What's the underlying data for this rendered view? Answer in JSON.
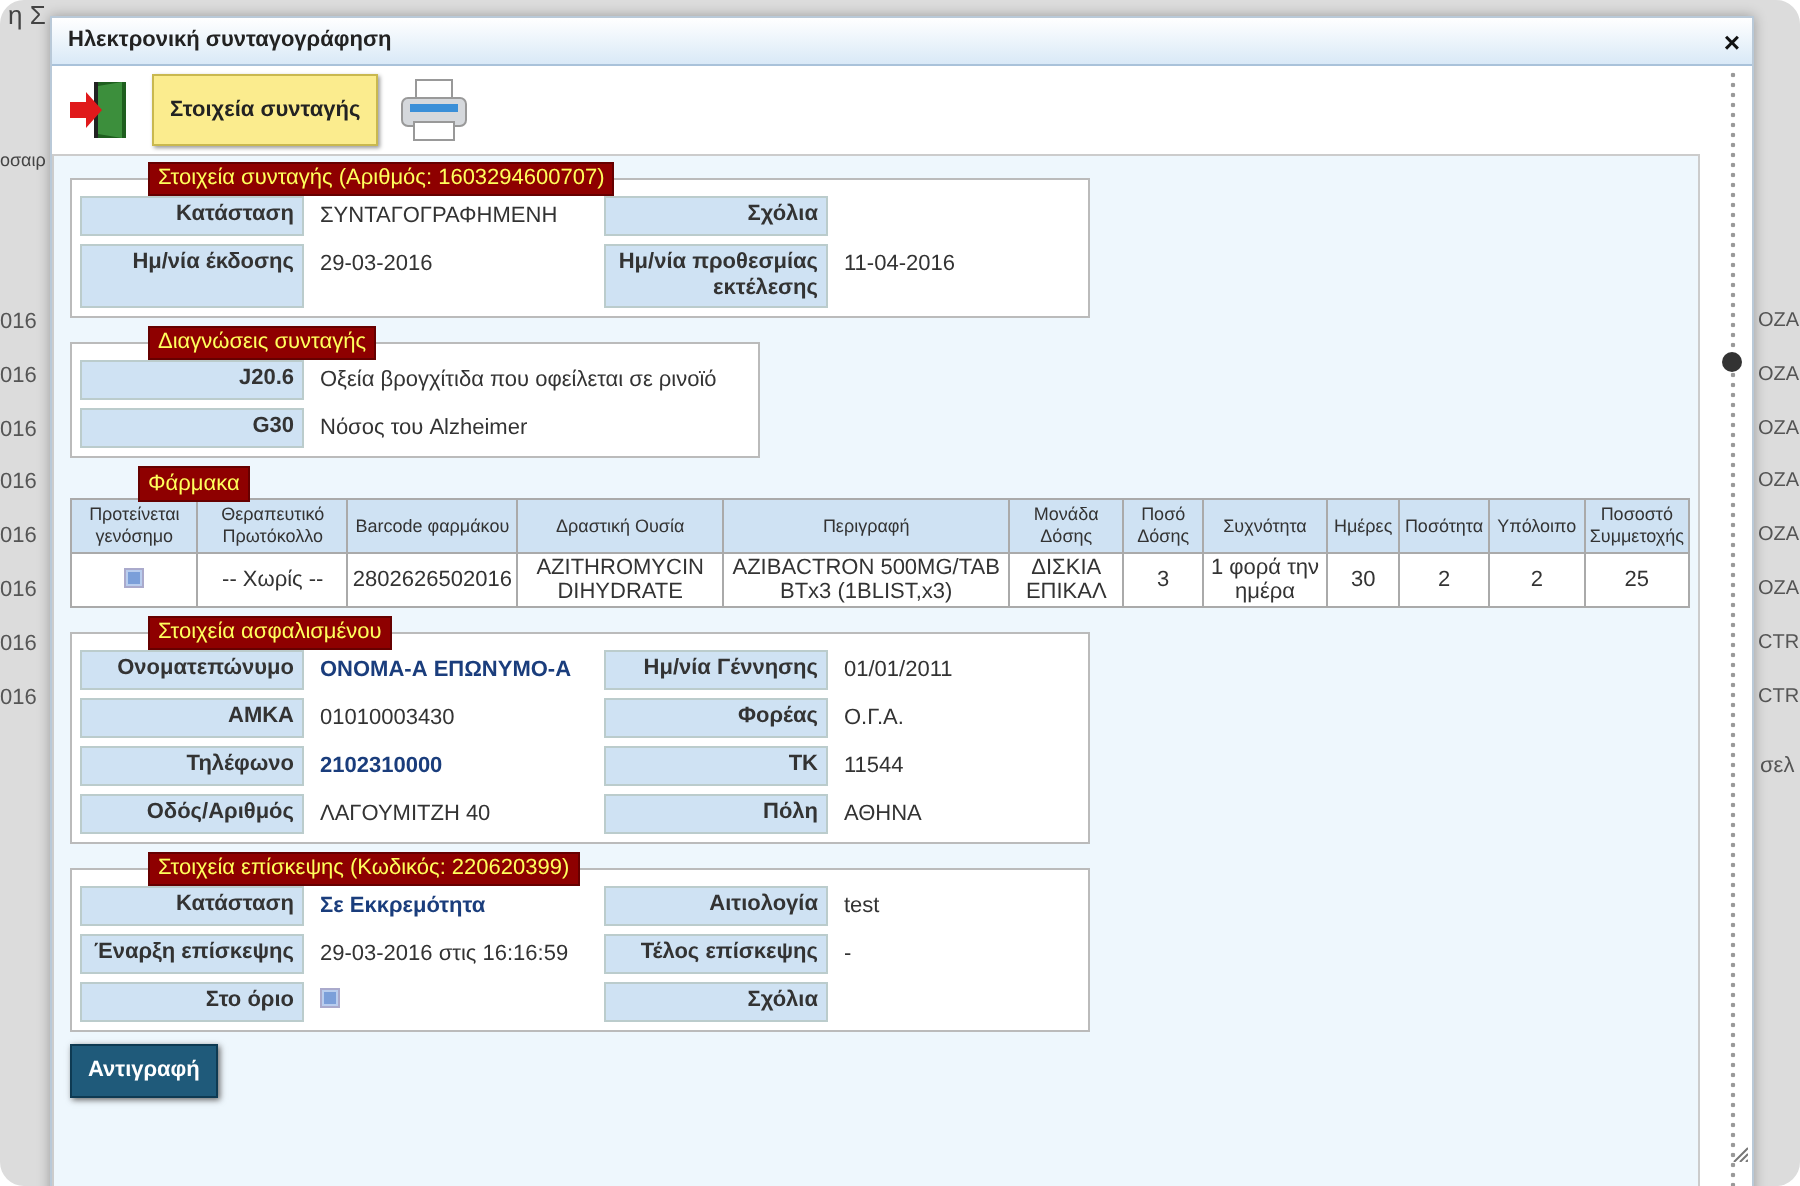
{
  "background": {
    "title": "η Σ",
    "column_header": "οσαιρ",
    "left_cells": [
      "016",
      "016",
      "016",
      "016",
      "016",
      "016",
      "016",
      "016"
    ],
    "right_cells": [
      "OZA",
      "OZA",
      "OZA",
      "OZA",
      "OZA",
      "OZA",
      "CTR",
      "CTR"
    ],
    "footer": "σελ"
  },
  "modal": {
    "title": "Ηλεκτρονική συνταγογράφηση",
    "close": "×"
  },
  "toolbar": {
    "tab": "Στοιχεία συνταγής"
  },
  "sections": [
    {
      "kind": "fields",
      "legend": "Στοιχεία συνταγής (Αριθμός: 1603294600707)",
      "fields": [
        {
          "label": "Κατάσταση",
          "kind": "text",
          "value": "ΣΥΝΤΑΓΟΓΡΑΦΗΜΕΝΗ",
          "emphasis": false
        },
        {
          "label": "Σχόλια",
          "kind": "text"
        },
        {
          "label": "Ημ/νία έκδοσης",
          "kind": "text",
          "value": "29-03-2016",
          "emphasis": false
        },
        {
          "label": "Ημ/νία προθεσμίας εκτέλεσης",
          "kind": "text",
          "value": "11-04-2016",
          "emphasis": false
        }
      ]
    },
    {
      "kind": "diagnoses",
      "legend": "Διαγνώσεις συνταγής",
      "items": [
        {
          "code": "J20.6",
          "description": "Οξεία βρογχίτιδα που οφείλεται σε ρινοϊό"
        },
        {
          "code": "G30",
          "description": "Νόσος του Alzheimer"
        }
      ]
    },
    {
      "kind": "table",
      "legend": "Φάρμακα",
      "columns": [
        "Προτείνεται γενόσημο",
        "Θεραπευτικό Πρωτόκολλο",
        "Barcode φαρμάκου",
        "Δραστική Ουσία",
        "Περιγραφή",
        "Μονάδα Δόσης",
        "Ποσό Δόσης",
        "Συχνότητα",
        "Ημέρες",
        "Ποσότητα",
        "Υπόλοιπο",
        "Ποσοστό Συμμετοχής"
      ],
      "rows": [
        {
          "cells": [
            {
              "kind": "checkbox",
              "checked": true
            },
            "-- Χωρίς --",
            "2802626502016",
            "AZITHROMYCIN DIHYDRATE",
            "AZIBACTRON 500MG/TAB BTx3 (1BLIST,x3)",
            "ΔΙΣΚΙΑ ΕΠΙΚΑΛ",
            "3",
            "1 φορά την ημέρα",
            "30",
            "2",
            "2",
            "25"
          ]
        }
      ]
    },
    {
      "kind": "fields",
      "legend": "Στοιχεία ασφαλισμένου",
      "fields": [
        {
          "label": "Ονοματεπώνυμο",
          "kind": "text",
          "value": "ΟΝΟΜΑ-Α ΕΠΩΝΥΜΟ-Α",
          "emphasis": true
        },
        {
          "label": "Ημ/νία Γέννησης",
          "kind": "text",
          "value": "01/01/2011",
          "emphasis": false
        },
        {
          "label": "ΑΜΚΑ",
          "kind": "text",
          "value": "01010003430",
          "emphasis": false
        },
        {
          "label": "Φορέας",
          "kind": "text",
          "value": "Ο.Γ.Α.",
          "emphasis": false
        },
        {
          "label": "Τηλέφωνο",
          "kind": "text",
          "value": "2102310000",
          "emphasis": true
        },
        {
          "label": "ΤΚ",
          "kind": "text",
          "value": "11544",
          "emphasis": false
        },
        {
          "label": "Οδός/Αριθμός",
          "kind": "text",
          "value": "ΛΑΓΟΥΜΙΤΖΗ 40",
          "emphasis": false
        },
        {
          "label": "Πόλη",
          "kind": "text",
          "value": "ΑΘΗΝΑ",
          "emphasis": false
        }
      ]
    },
    {
      "kind": "fields",
      "legend": "Στοιχεία επίσκεψης (Κωδικός: 220620399)",
      "fields": [
        {
          "label": "Κατάσταση",
          "kind": "text",
          "value": "Σε Εκκρεμότητα",
          "emphasis": true
        },
        {
          "label": "Αιτιολογία",
          "kind": "text",
          "value": "test",
          "emphasis": false
        },
        {
          "label": "Έναρξη επίσκεψης",
          "kind": "text",
          "value": "29-03-2016 στις 16:16:59",
          "emphasis": false
        },
        {
          "label": "Τέλος επίσκεψης",
          "kind": "text",
          "value": "-",
          "emphasis": false
        },
        {
          "label": "Στο όριο",
          "kind": "checkbox",
          "checked": true
        },
        {
          "label": "Σχόλια",
          "kind": "text"
        }
      ]
    }
  ],
  "copy_button": "Αντιγραφή"
}
